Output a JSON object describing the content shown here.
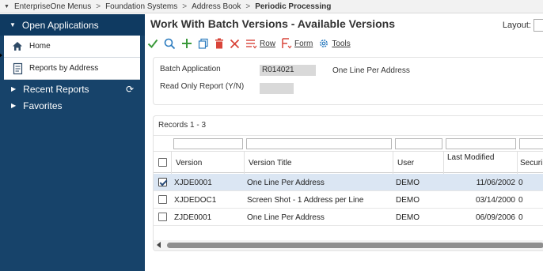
{
  "breadcrumb": {
    "items": [
      "EnterpriseOne Menus",
      "Foundation Systems",
      "Address Book",
      "Periodic Processing"
    ],
    "separator": ">"
  },
  "sidebar": {
    "open_apps_label": "Open Applications",
    "items": [
      {
        "label": "Home",
        "icon": "home-icon"
      },
      {
        "label": "Reports by Address",
        "icon": "document-icon"
      }
    ],
    "recent_reports_label": "Recent Reports",
    "favorites_label": "Favorites"
  },
  "main": {
    "title": "Work With Batch Versions - Available Versions",
    "layout_label": "Layout:",
    "toolbar": {
      "row_label": "Row",
      "form_label": "Form",
      "tools_label": "Tools"
    },
    "header": {
      "batch_application_label": "Batch Application",
      "batch_application_value": "R014021",
      "batch_application_desc": "One Line Per Address",
      "read_only_label": "Read Only Report (Y/N)",
      "read_only_value": ""
    },
    "grid": {
      "records_label": "Records 1 - 3",
      "columns": [
        "Version",
        "Version Title",
        "User",
        "Last Modified",
        "Securi"
      ],
      "rows": [
        {
          "selected": true,
          "version": "XJDE0001",
          "title": "One Line Per Address",
          "user": "DEMO",
          "modified": "11/06/2002",
          "security": "0"
        },
        {
          "selected": false,
          "version": "XJDEDOC1",
          "title": "Screen Shot - 1 Address per Line",
          "user": "DEMO",
          "modified": "03/14/2000",
          "security": "0"
        },
        {
          "selected": false,
          "version": "ZJDE0001",
          "title": "One Line Per Address",
          "user": "DEMO",
          "modified": "06/09/2006",
          "security": "0"
        }
      ]
    }
  },
  "colors": {
    "sidebar_bg": "#17436a",
    "accent_green": "#3c9a3c",
    "accent_red": "#d9453a",
    "accent_blue": "#2b7bbf",
    "selected_row": "#dbe6f3"
  }
}
